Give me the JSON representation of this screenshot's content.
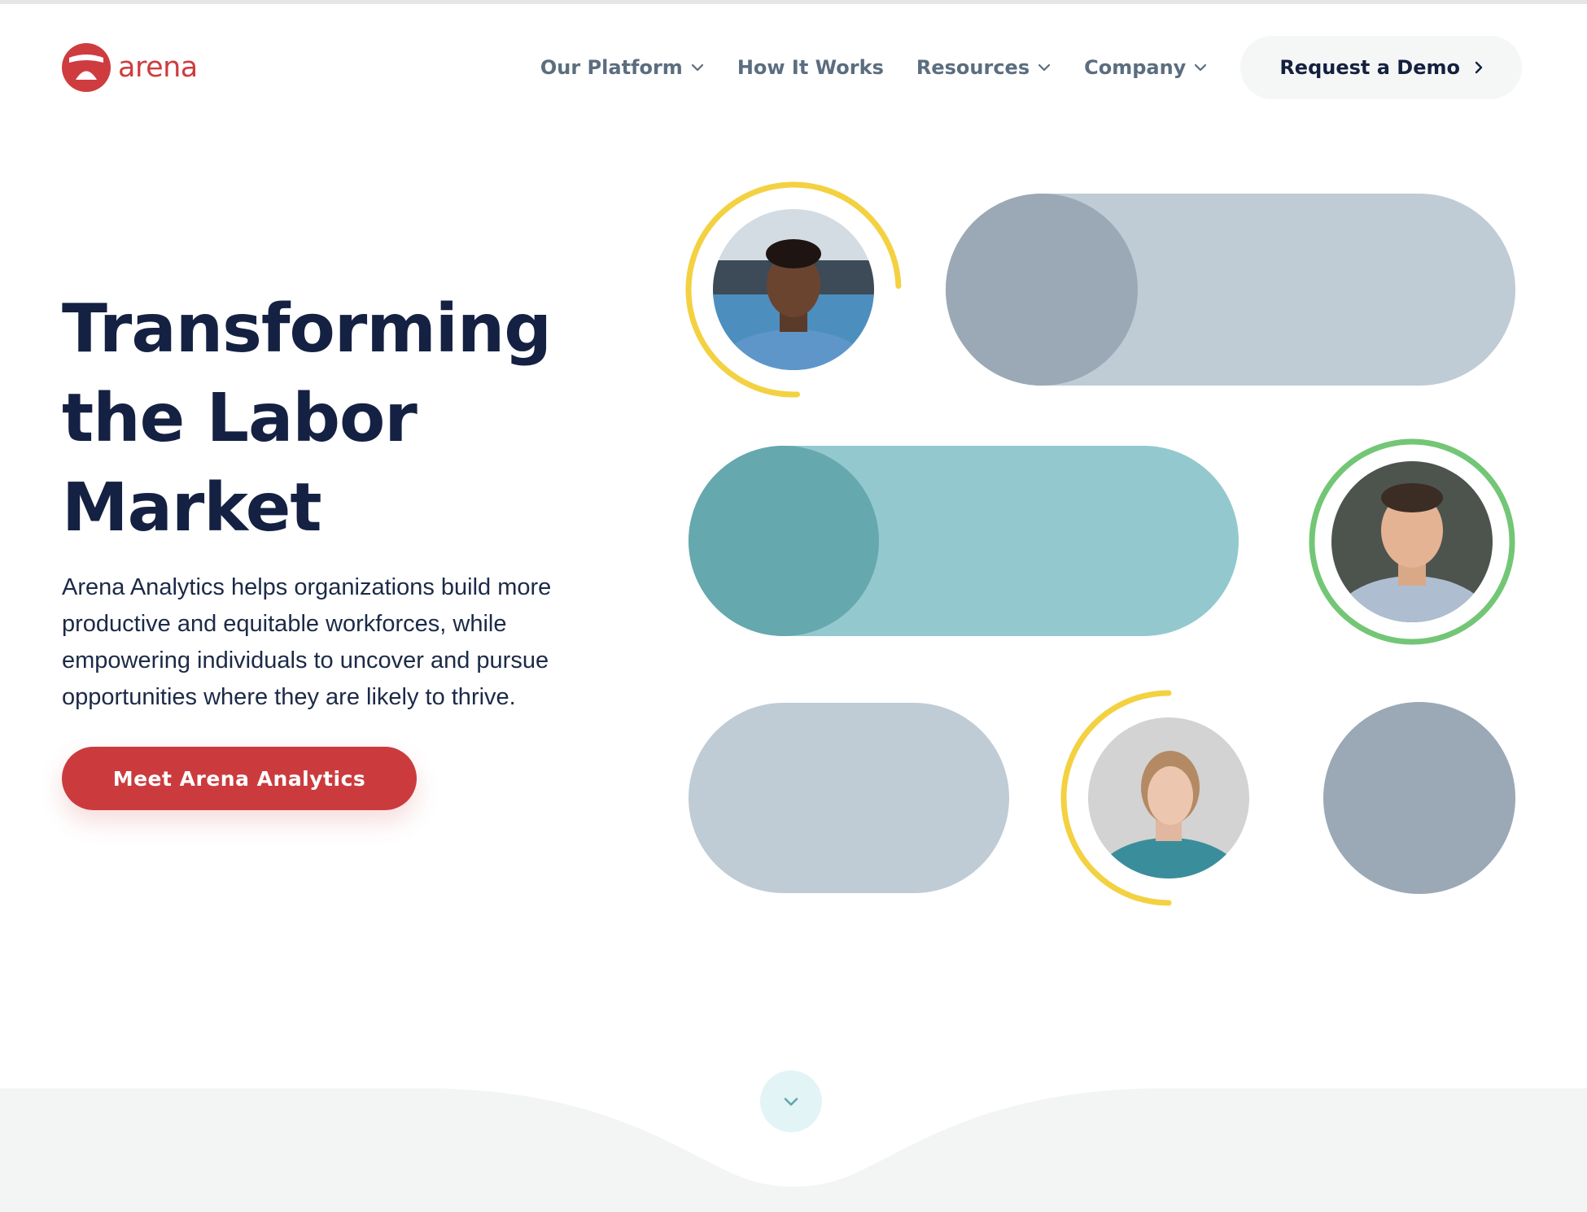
{
  "brand": {
    "name": "arena",
    "color": "#cf3c3f"
  },
  "nav": {
    "items": [
      {
        "label": "Our Platform",
        "has_dropdown": true
      },
      {
        "label": "How It Works",
        "has_dropdown": false
      },
      {
        "label": "Resources",
        "has_dropdown": true
      },
      {
        "label": "Company",
        "has_dropdown": true
      }
    ],
    "cta_label": "Request a Demo"
  },
  "hero": {
    "title": "Transforming the Labor Market",
    "subtitle": "Arena Analytics helps organizations build more productive and equitable workforces, while empowering individuals to uncover and pursue opportunities where they are likely to thrive.",
    "cta_label": "Meet Arena Analytics"
  },
  "icons": {
    "nav_dropdown": "chevron-down-icon",
    "demo_arrow": "chevron-right-icon",
    "scroll": "chevron-down-icon"
  },
  "colors": {
    "navy": "#142142",
    "accent_red": "#cb3b3e",
    "slate_light": "#bfccd6",
    "slate_dark": "#9aa9b5",
    "teal_light": "#93c9ce",
    "teal_dark": "#65a8ae",
    "ring_yellow": "#f3d141",
    "ring_green": "#73c676"
  }
}
